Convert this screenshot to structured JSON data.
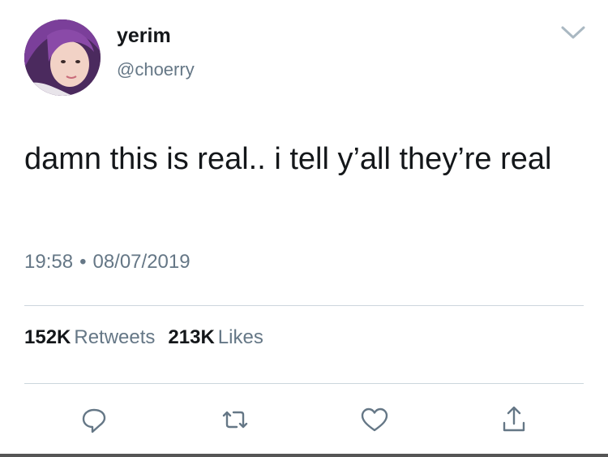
{
  "user": {
    "display_name": "yerim",
    "handle": "@choerry"
  },
  "tweet": {
    "text": "damn this is real.. i tell y’all they’re real",
    "time": "19:58",
    "date": "08/07/2019"
  },
  "stats": {
    "retweets_count": "152K",
    "retweets_label": "Retweets",
    "likes_count": "213K",
    "likes_label": "Likes"
  },
  "icons": {
    "menu": "chevron-down-icon",
    "reply": "reply-icon",
    "retweet": "retweet-icon",
    "like": "heart-icon",
    "share": "share-icon"
  },
  "colors": {
    "text": "#14171a",
    "secondary": "#657786",
    "divider": "#ccd6dd",
    "icon": "#657786"
  }
}
